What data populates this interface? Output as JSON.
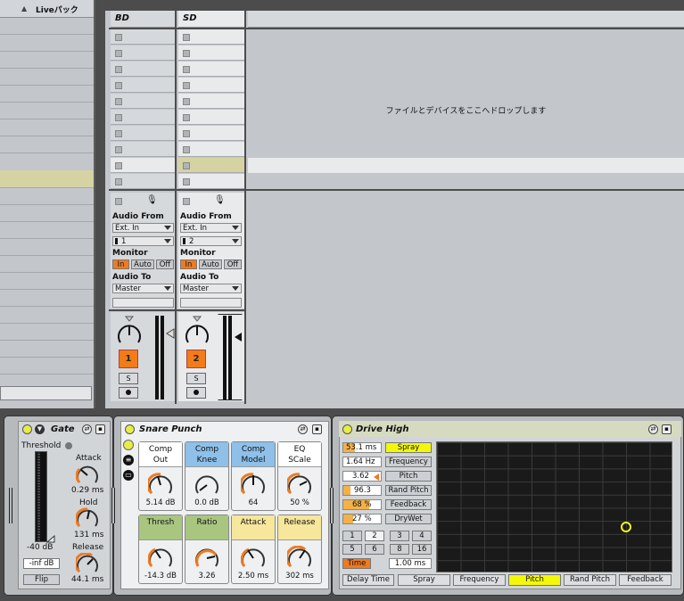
{
  "browser": {
    "column_header": "Liveパック"
  },
  "session": {
    "tracks": [
      {
        "name": "BD",
        "audio_from_label": "Audio From",
        "audio_from": "Ext. In",
        "channel": "1",
        "monitor_label": "Monitor",
        "monitor": [
          "In",
          "Auto",
          "Off"
        ],
        "monitor_active": "In",
        "audio_to_label": "Audio To",
        "audio_to": "Master",
        "arm_number": "1",
        "solo": "S"
      },
      {
        "name": "SD",
        "audio_from_label": "Audio From",
        "audio_from": "Ext. In",
        "channel": "2",
        "monitor_label": "Monitor",
        "monitor": [
          "In",
          "Auto",
          "Off"
        ],
        "monitor_active": "In",
        "audio_to_label": "Audio To",
        "audio_to": "Master",
        "arm_number": "2",
        "solo": "S"
      }
    ],
    "drop_hint": "ファイルとデバイスをここへドロップします"
  },
  "devices": {
    "gate": {
      "title": "Gate",
      "threshold_label": "Threshold",
      "threshold_value": "-40 dB",
      "attack_label": "Attack",
      "attack_value": "0.29 ms",
      "hold_label": "Hold",
      "hold_value": "131 ms",
      "release_label": "Release",
      "release_value": "44.1 ms",
      "return_value": "-inf dB",
      "flip_label": "Flip"
    },
    "rack": {
      "title": "Snare Punch",
      "macros": [
        {
          "label": "Comp\nOut",
          "value": "5.14 dB",
          "color": "#ffffff"
        },
        {
          "label": "Comp\nKnee",
          "value": "0.0 dB",
          "color": "#8ec0ea"
        },
        {
          "label": "Comp\nModel",
          "value": "64",
          "color": "#8ec0ea"
        },
        {
          "label": "EQ\nSCale",
          "value": "50 %",
          "color": "#ffffff"
        },
        {
          "label": "Thresh",
          "value": "-14.3 dB",
          "color": "#a9c681"
        },
        {
          "label": "Ratio",
          "value": "3.26",
          "color": "#a9c681"
        },
        {
          "label": "Attack",
          "value": "2.50 ms",
          "color": "#f6e79c"
        },
        {
          "label": "Release",
          "value": "302 ms",
          "color": "#f6e79c"
        }
      ]
    },
    "drive": {
      "title": "Drive High",
      "params": [
        {
          "value": "53.1 ms",
          "label": "Spray",
          "fill": 0.3
        },
        {
          "value": "1.64 Hz",
          "label": "Frequency",
          "fill": 0
        },
        {
          "value": "3.62",
          "label": "Pitch",
          "fill": 0
        },
        {
          "value": "96.3",
          "label": "Rand Pitch",
          "fill": 0.2
        },
        {
          "value": "68 %",
          "label": "Feedback",
          "fill": 0.68
        },
        {
          "value": "27 %",
          "label": "DryWet",
          "fill": 0.27
        }
      ],
      "divisions": [
        "1",
        "2",
        "3",
        "4",
        "5",
        "6",
        "8",
        "16"
      ],
      "time_label": "Time",
      "time_value": "1.00 ms",
      "tabs": [
        "Delay Time",
        "Spray",
        "Frequency",
        "Pitch",
        "Rand Pitch",
        "Feedback"
      ],
      "active_tab": "Pitch",
      "highlight_color": "#f3f80a"
    }
  }
}
